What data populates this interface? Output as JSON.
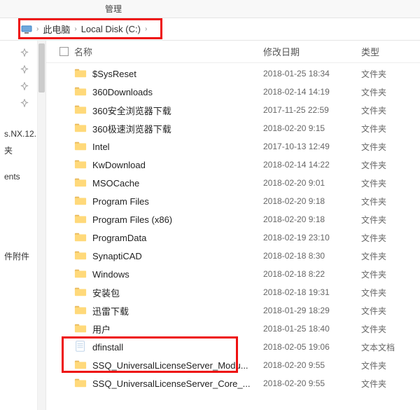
{
  "topbar": {
    "manage": "管理"
  },
  "breadcrumb": {
    "this_pc": "此电脑",
    "disk": "Local Disk (C:)"
  },
  "columns": {
    "name": "名称",
    "date": "修改日期",
    "type": "类型"
  },
  "sidebar": {
    "items": [
      {
        "label": "s.NX.12."
      },
      {
        "label": "夹"
      },
      {
        "label": "ents"
      },
      {
        "label": "件附件"
      }
    ]
  },
  "type_labels": {
    "folder": "文件夹",
    "text": "文本文档"
  },
  "rows": [
    {
      "name": "$SysReset",
      "date": "2018-01-25 18:34",
      "type": "文件夹",
      "kind": "folder"
    },
    {
      "name": "360Downloads",
      "date": "2018-02-14 14:19",
      "type": "文件夹",
      "kind": "folder"
    },
    {
      "name": "360安全浏览器下载",
      "date": "2017-11-25 22:59",
      "type": "文件夹",
      "kind": "folder"
    },
    {
      "name": "360极速浏览器下载",
      "date": "2018-02-20 9:15",
      "type": "文件夹",
      "kind": "folder"
    },
    {
      "name": "Intel",
      "date": "2017-10-13 12:49",
      "type": "文件夹",
      "kind": "folder"
    },
    {
      "name": "KwDownload",
      "date": "2018-02-14 14:22",
      "type": "文件夹",
      "kind": "folder"
    },
    {
      "name": "MSOCache",
      "date": "2018-02-20 9:01",
      "type": "文件夹",
      "kind": "folder"
    },
    {
      "name": "Program Files",
      "date": "2018-02-20 9:18",
      "type": "文件夹",
      "kind": "folder"
    },
    {
      "name": "Program Files (x86)",
      "date": "2018-02-20 9:18",
      "type": "文件夹",
      "kind": "folder"
    },
    {
      "name": "ProgramData",
      "date": "2018-02-19 23:10",
      "type": "文件夹",
      "kind": "folder"
    },
    {
      "name": "SynaptiCAD",
      "date": "2018-02-18 8:30",
      "type": "文件夹",
      "kind": "folder"
    },
    {
      "name": "Windows",
      "date": "2018-02-18 8:22",
      "type": "文件夹",
      "kind": "folder"
    },
    {
      "name": "安装包",
      "date": "2018-02-18 19:31",
      "type": "文件夹",
      "kind": "folder"
    },
    {
      "name": "迅雷下载",
      "date": "2018-01-29 18:29",
      "type": "文件夹",
      "kind": "folder"
    },
    {
      "name": "用户",
      "date": "2018-01-25 18:40",
      "type": "文件夹",
      "kind": "folder"
    },
    {
      "name": "dfinstall",
      "date": "2018-02-05 19:06",
      "type": "文本文档",
      "kind": "text"
    },
    {
      "name": "SSQ_UniversalLicenseServer_Modu...",
      "date": "2018-02-20 9:55",
      "type": "文件夹",
      "kind": "folder"
    },
    {
      "name": "SSQ_UniversalLicenseServer_Core_...",
      "date": "2018-02-20 9:55",
      "type": "文件夹",
      "kind": "folder"
    }
  ]
}
